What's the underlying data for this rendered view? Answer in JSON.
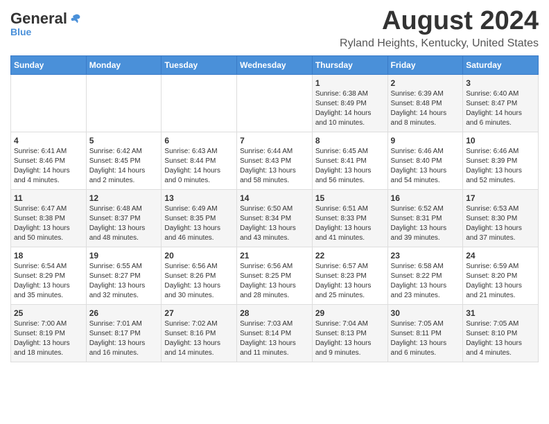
{
  "header": {
    "logo_general": "General",
    "logo_blue": "Blue",
    "month_title": "August 2024",
    "location": "Ryland Heights, Kentucky, United States"
  },
  "days_of_week": [
    "Sunday",
    "Monday",
    "Tuesday",
    "Wednesday",
    "Thursday",
    "Friday",
    "Saturday"
  ],
  "weeks": [
    [
      {
        "day": "",
        "info": ""
      },
      {
        "day": "",
        "info": ""
      },
      {
        "day": "",
        "info": ""
      },
      {
        "day": "",
        "info": ""
      },
      {
        "day": "1",
        "info": "Sunrise: 6:38 AM\nSunset: 8:49 PM\nDaylight: 14 hours\nand 10 minutes."
      },
      {
        "day": "2",
        "info": "Sunrise: 6:39 AM\nSunset: 8:48 PM\nDaylight: 14 hours\nand 8 minutes."
      },
      {
        "day": "3",
        "info": "Sunrise: 6:40 AM\nSunset: 8:47 PM\nDaylight: 14 hours\nand 6 minutes."
      }
    ],
    [
      {
        "day": "4",
        "info": "Sunrise: 6:41 AM\nSunset: 8:46 PM\nDaylight: 14 hours\nand 4 minutes."
      },
      {
        "day": "5",
        "info": "Sunrise: 6:42 AM\nSunset: 8:45 PM\nDaylight: 14 hours\nand 2 minutes."
      },
      {
        "day": "6",
        "info": "Sunrise: 6:43 AM\nSunset: 8:44 PM\nDaylight: 14 hours\nand 0 minutes."
      },
      {
        "day": "7",
        "info": "Sunrise: 6:44 AM\nSunset: 8:43 PM\nDaylight: 13 hours\nand 58 minutes."
      },
      {
        "day": "8",
        "info": "Sunrise: 6:45 AM\nSunset: 8:41 PM\nDaylight: 13 hours\nand 56 minutes."
      },
      {
        "day": "9",
        "info": "Sunrise: 6:46 AM\nSunset: 8:40 PM\nDaylight: 13 hours\nand 54 minutes."
      },
      {
        "day": "10",
        "info": "Sunrise: 6:46 AM\nSunset: 8:39 PM\nDaylight: 13 hours\nand 52 minutes."
      }
    ],
    [
      {
        "day": "11",
        "info": "Sunrise: 6:47 AM\nSunset: 8:38 PM\nDaylight: 13 hours\nand 50 minutes."
      },
      {
        "day": "12",
        "info": "Sunrise: 6:48 AM\nSunset: 8:37 PM\nDaylight: 13 hours\nand 48 minutes."
      },
      {
        "day": "13",
        "info": "Sunrise: 6:49 AM\nSunset: 8:35 PM\nDaylight: 13 hours\nand 46 minutes."
      },
      {
        "day": "14",
        "info": "Sunrise: 6:50 AM\nSunset: 8:34 PM\nDaylight: 13 hours\nand 43 minutes."
      },
      {
        "day": "15",
        "info": "Sunrise: 6:51 AM\nSunset: 8:33 PM\nDaylight: 13 hours\nand 41 minutes."
      },
      {
        "day": "16",
        "info": "Sunrise: 6:52 AM\nSunset: 8:31 PM\nDaylight: 13 hours\nand 39 minutes."
      },
      {
        "day": "17",
        "info": "Sunrise: 6:53 AM\nSunset: 8:30 PM\nDaylight: 13 hours\nand 37 minutes."
      }
    ],
    [
      {
        "day": "18",
        "info": "Sunrise: 6:54 AM\nSunset: 8:29 PM\nDaylight: 13 hours\nand 35 minutes."
      },
      {
        "day": "19",
        "info": "Sunrise: 6:55 AM\nSunset: 8:27 PM\nDaylight: 13 hours\nand 32 minutes."
      },
      {
        "day": "20",
        "info": "Sunrise: 6:56 AM\nSunset: 8:26 PM\nDaylight: 13 hours\nand 30 minutes."
      },
      {
        "day": "21",
        "info": "Sunrise: 6:56 AM\nSunset: 8:25 PM\nDaylight: 13 hours\nand 28 minutes."
      },
      {
        "day": "22",
        "info": "Sunrise: 6:57 AM\nSunset: 8:23 PM\nDaylight: 13 hours\nand 25 minutes."
      },
      {
        "day": "23",
        "info": "Sunrise: 6:58 AM\nSunset: 8:22 PM\nDaylight: 13 hours\nand 23 minutes."
      },
      {
        "day": "24",
        "info": "Sunrise: 6:59 AM\nSunset: 8:20 PM\nDaylight: 13 hours\nand 21 minutes."
      }
    ],
    [
      {
        "day": "25",
        "info": "Sunrise: 7:00 AM\nSunset: 8:19 PM\nDaylight: 13 hours\nand 18 minutes."
      },
      {
        "day": "26",
        "info": "Sunrise: 7:01 AM\nSunset: 8:17 PM\nDaylight: 13 hours\nand 16 minutes."
      },
      {
        "day": "27",
        "info": "Sunrise: 7:02 AM\nSunset: 8:16 PM\nDaylight: 13 hours\nand 14 minutes."
      },
      {
        "day": "28",
        "info": "Sunrise: 7:03 AM\nSunset: 8:14 PM\nDaylight: 13 hours\nand 11 minutes."
      },
      {
        "day": "29",
        "info": "Sunrise: 7:04 AM\nSunset: 8:13 PM\nDaylight: 13 hours\nand 9 minutes."
      },
      {
        "day": "30",
        "info": "Sunrise: 7:05 AM\nSunset: 8:11 PM\nDaylight: 13 hours\nand 6 minutes."
      },
      {
        "day": "31",
        "info": "Sunrise: 7:05 AM\nSunset: 8:10 PM\nDaylight: 13 hours\nand 4 minutes."
      }
    ]
  ]
}
